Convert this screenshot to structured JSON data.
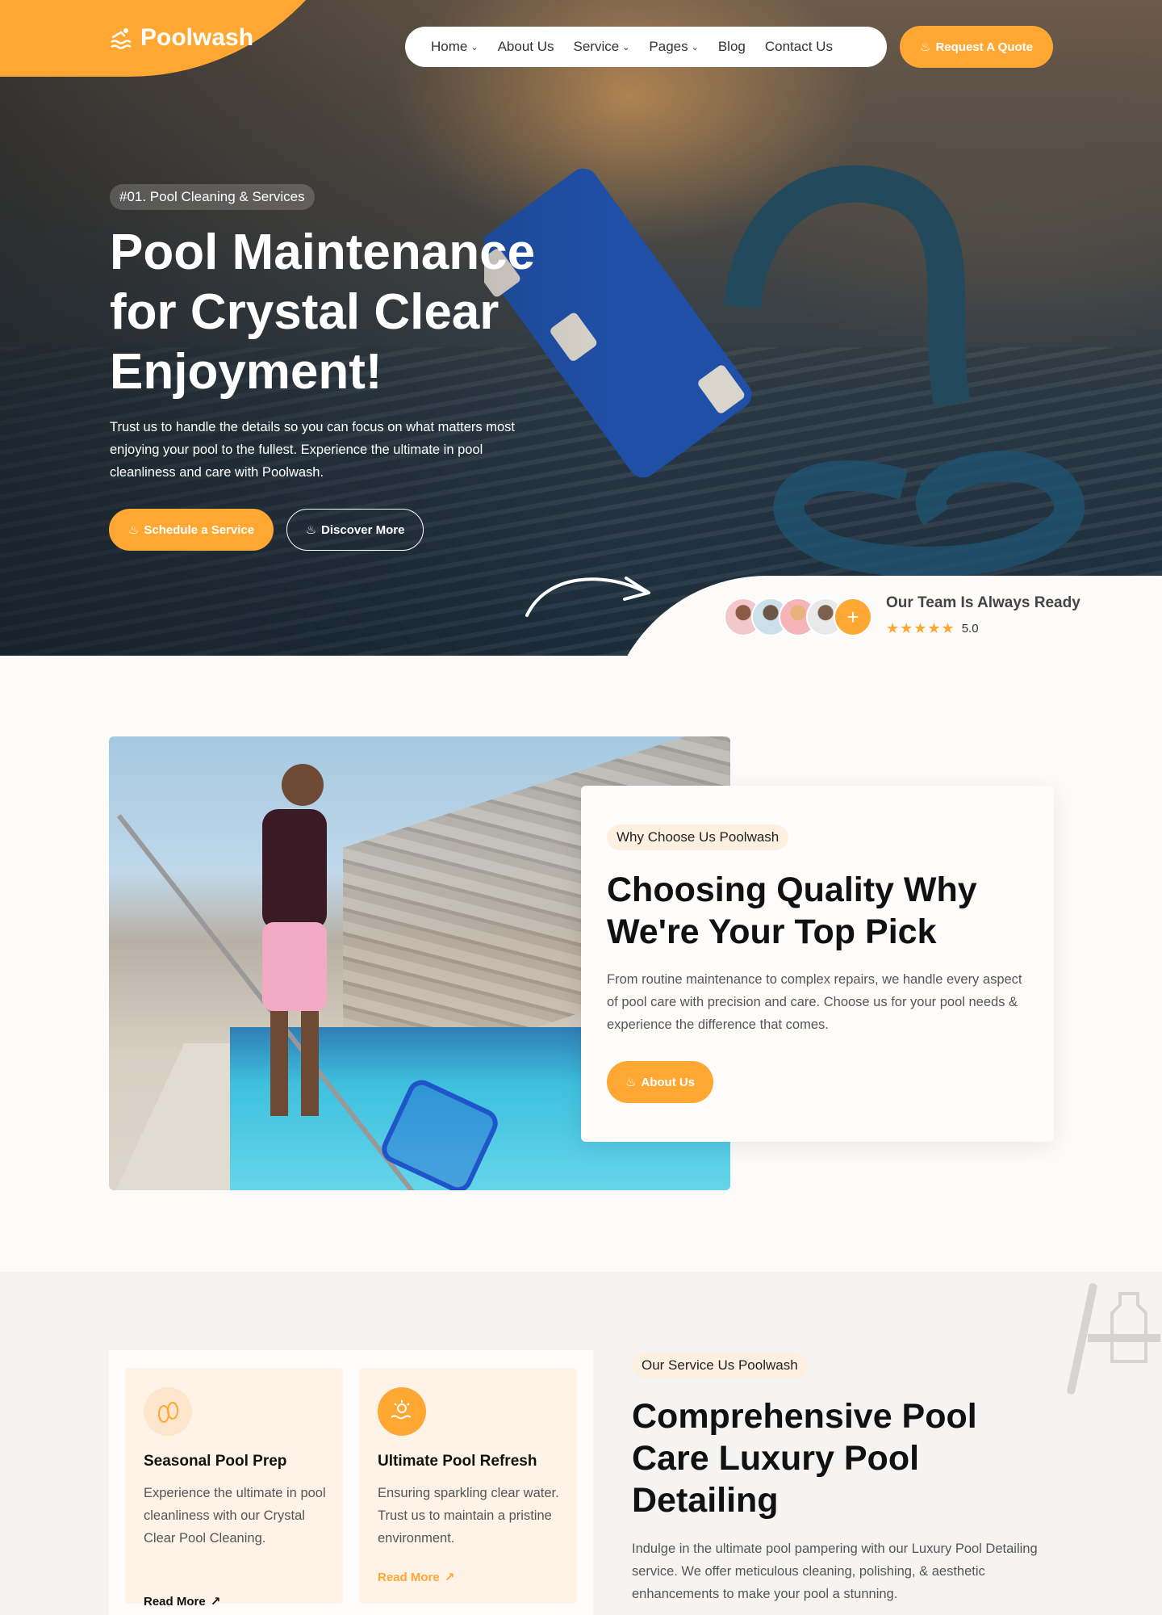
{
  "brand": {
    "name": "Poolwash",
    "accent": "#ffa733"
  },
  "nav": {
    "items": [
      {
        "label": "Home",
        "dropdown": true
      },
      {
        "label": "About Us",
        "dropdown": false
      },
      {
        "label": "Service",
        "dropdown": true
      },
      {
        "label": "Pages",
        "dropdown": true
      },
      {
        "label": "Blog",
        "dropdown": false
      },
      {
        "label": "Contact Us",
        "dropdown": false
      }
    ],
    "cta": "Request A Quote"
  },
  "hero": {
    "tag": "#01. Pool Cleaning & Services",
    "title": "Pool Maintenance for Crystal Clear Enjoyment!",
    "description": "Trust us to handle the details so you can focus on what matters most enjoying your pool to the fullest. Experience the ultimate in pool cleanliness and care with Poolwash.",
    "primary_button": "Schedule a Service",
    "secondary_button": "Discover More",
    "team": {
      "title": "Our Team Is Always Ready",
      "rating": "5.0",
      "stars": 5
    }
  },
  "why": {
    "tag": "Why Choose Us Poolwash",
    "title": "Choosing Quality Why We're Your Top Pick",
    "description": "From routine maintenance to complex repairs, we handle every aspect of pool care with precision and care. Choose us for your pool needs & experience the difference that comes.",
    "button": "About Us"
  },
  "services": {
    "tag": "Our Service Us Poolwash",
    "title": "Comprehensive Pool Care Luxury Pool Detailing",
    "description": "Indulge in the ultimate pool pampering with our Luxury Pool Detailing service. We offer meticulous cleaning, polishing, & aesthetic enhancements to make your pool a stunning.",
    "cards": [
      {
        "icon": "flip-flops-icon",
        "title": "Seasonal Pool Prep",
        "description": "Experience the ultimate in pool cleanliness with our Crystal Clear Pool Cleaning.",
        "link": "Read More"
      },
      {
        "icon": "sun-water-icon",
        "title": "Ultimate Pool Refresh",
        "description": "Ensuring sparkling clear water. Trust us to maintain a pristine environment.",
        "link": "Read More"
      }
    ]
  }
}
